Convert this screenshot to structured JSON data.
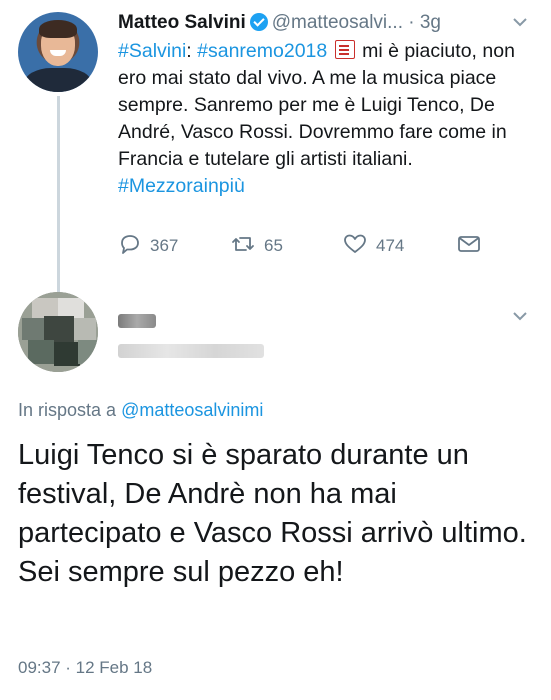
{
  "tweet": {
    "author_name": "Matteo Salvini",
    "handle": "@matteosalvi...",
    "separator": "·",
    "time": "3g",
    "body_parts": {
      "tag1": "#Salvini",
      "colon": ": ",
      "tag2": "#sanremo2018",
      "text1": " mi è piaciuto, non ero mai stato dal vivo. A me la musica piace sempre. Sanremo per me è Luigi Tenco, De André, Vasco Rossi. Dovremmo fare come in Francia e tutelare gli artisti italiani. ",
      "tag3": "#Mezzorainpiù"
    },
    "actions": {
      "reply_count": "367",
      "retweet_count": "65",
      "like_count": "474"
    }
  },
  "reply": {
    "in_reply_prefix": "In risposta a ",
    "in_reply_handle": "@matteosalvinimi",
    "lines": [
      "Luigi Tenco si è sparato durante un festival, De Andrè non ha mai partecipato e Vasco Rossi arrivò ultimo.",
      "Sei sempre sul pezzo eh!"
    ],
    "timestamp": "09:37 · 12 Feb 18"
  },
  "colors": {
    "link": "#1b95e0",
    "muted": "#657786",
    "verified": "#1da1f2"
  },
  "icons": [
    "verified-badge-icon",
    "chevron-down-icon",
    "reply-icon",
    "retweet-icon",
    "like-icon",
    "direct-message-icon",
    "memo-emoji-icon"
  ]
}
